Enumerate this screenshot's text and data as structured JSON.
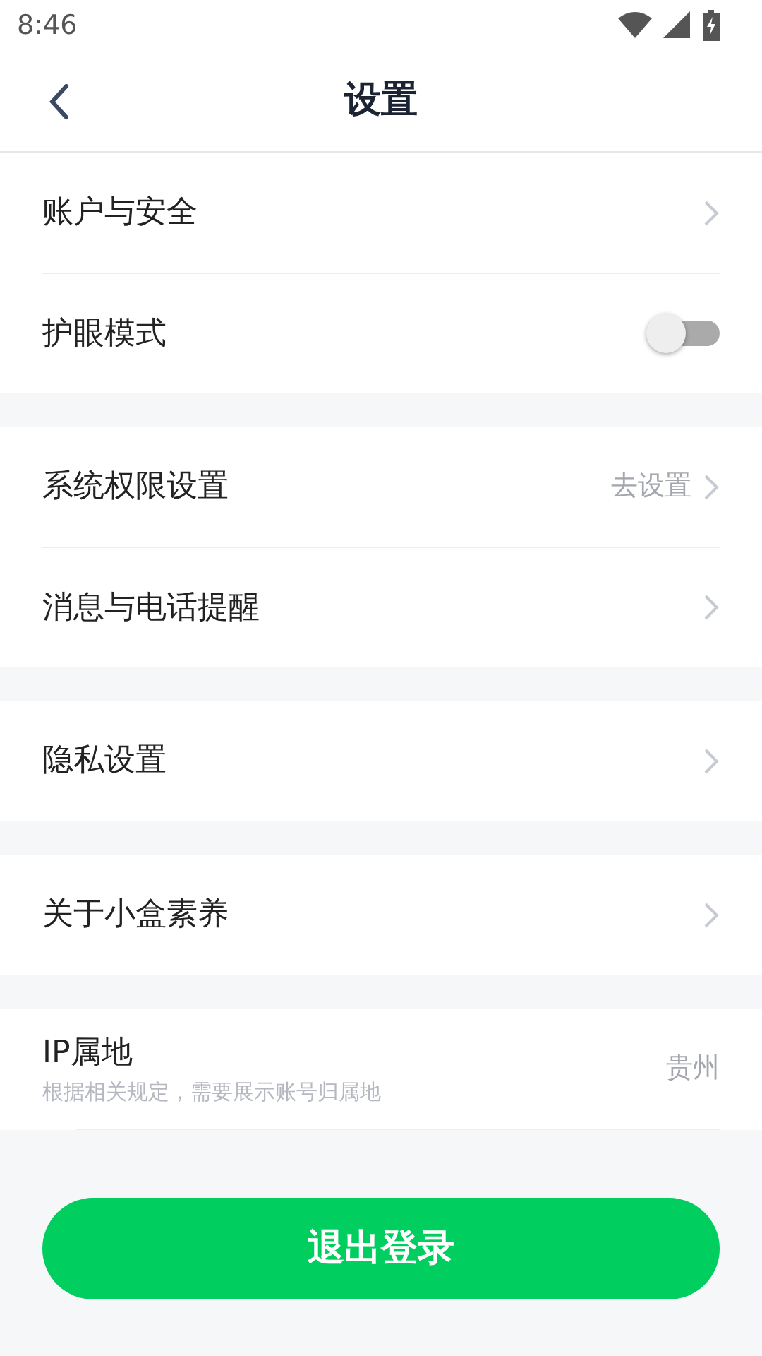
{
  "status_bar": {
    "time": "8:46"
  },
  "header": {
    "title": "设置"
  },
  "groups": [
    {
      "rows": [
        {
          "kind": "link",
          "label": "账户与安全"
        },
        {
          "kind": "toggle",
          "label": "护眼模式",
          "on": false
        }
      ]
    },
    {
      "rows": [
        {
          "kind": "link",
          "label": "系统权限设置",
          "value": "去设置"
        },
        {
          "kind": "link",
          "label": "消息与电话提醒"
        }
      ]
    },
    {
      "rows": [
        {
          "kind": "link",
          "label": "隐私设置"
        }
      ]
    },
    {
      "rows": [
        {
          "kind": "link",
          "label": "关于小盒素养"
        }
      ]
    },
    {
      "rows": [
        {
          "kind": "info",
          "label": "IP属地",
          "subtitle": "根据相关规定，需要展示账号归属地",
          "value": "贵州"
        }
      ]
    }
  ],
  "logout_button": "退出登录"
}
